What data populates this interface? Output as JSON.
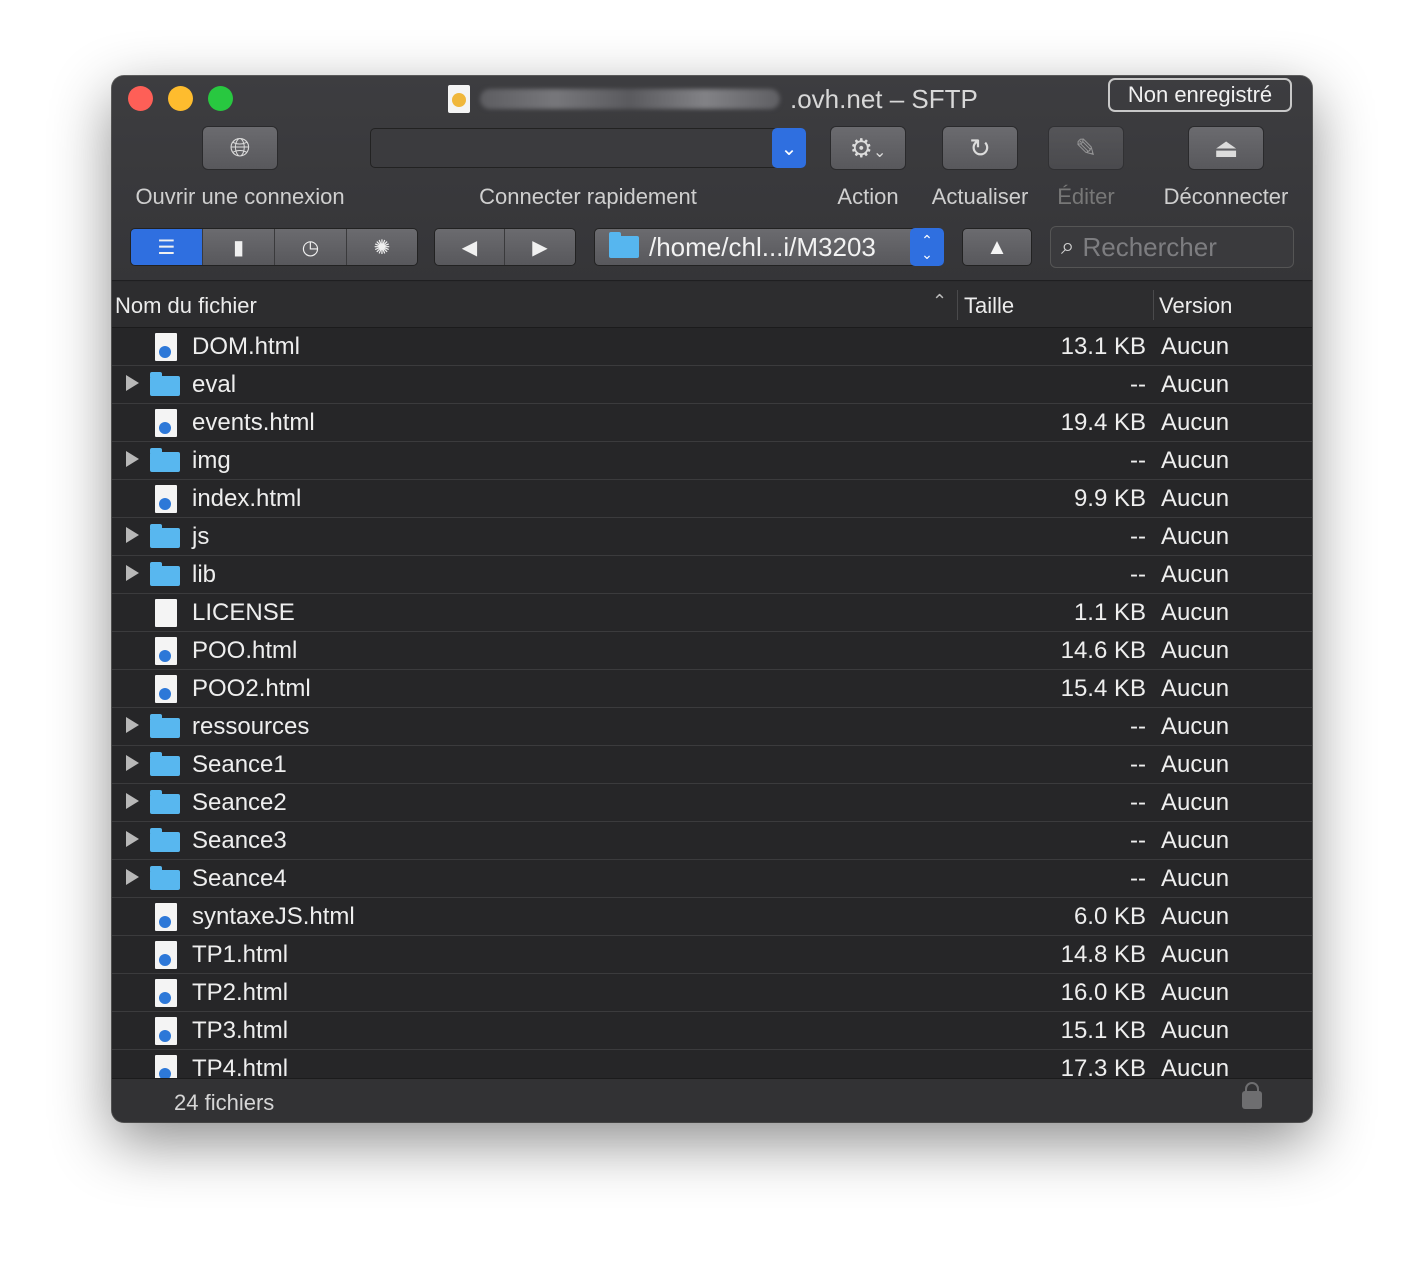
{
  "window": {
    "title_suffix": ".ovh.net – SFTP",
    "unregistered_label": "Non enregistré"
  },
  "toolbar": {
    "open_connection": "Ouvrir une connexion",
    "quick_connect": "Connecter rapidement",
    "action": "Action",
    "refresh": "Actualiser",
    "edit": "Éditer",
    "disconnect": "Déconnecter"
  },
  "navigation": {
    "path": "/home/chl...i/M3203",
    "search_placeholder": "Rechercher"
  },
  "columns": {
    "name": "Nom du fichier",
    "size": "Taille",
    "version": "Version"
  },
  "files": [
    {
      "name": "DOM.html",
      "type": "html",
      "size": "13.1 KB",
      "version": "Aucun"
    },
    {
      "name": "eval",
      "type": "folder",
      "size": "--",
      "version": "Aucun"
    },
    {
      "name": "events.html",
      "type": "html",
      "size": "19.4 KB",
      "version": "Aucun"
    },
    {
      "name": "img",
      "type": "folder",
      "size": "--",
      "version": "Aucun"
    },
    {
      "name": "index.html",
      "type": "html",
      "size": "9.9 KB",
      "version": "Aucun"
    },
    {
      "name": "js",
      "type": "folder",
      "size": "--",
      "version": "Aucun"
    },
    {
      "name": "lib",
      "type": "folder",
      "size": "--",
      "version": "Aucun"
    },
    {
      "name": "LICENSE",
      "type": "file",
      "size": "1.1 KB",
      "version": "Aucun"
    },
    {
      "name": "POO.html",
      "type": "html",
      "size": "14.6 KB",
      "version": "Aucun"
    },
    {
      "name": "POO2.html",
      "type": "html",
      "size": "15.4 KB",
      "version": "Aucun"
    },
    {
      "name": "ressources",
      "type": "folder",
      "size": "--",
      "version": "Aucun"
    },
    {
      "name": "Seance1",
      "type": "folder",
      "size": "--",
      "version": "Aucun"
    },
    {
      "name": "Seance2",
      "type": "folder",
      "size": "--",
      "version": "Aucun"
    },
    {
      "name": "Seance3",
      "type": "folder",
      "size": "--",
      "version": "Aucun"
    },
    {
      "name": "Seance4",
      "type": "folder",
      "size": "--",
      "version": "Aucun"
    },
    {
      "name": "syntaxeJS.html",
      "type": "html",
      "size": "6.0 KB",
      "version": "Aucun"
    },
    {
      "name": "TP1.html",
      "type": "html",
      "size": "14.8 KB",
      "version": "Aucun"
    },
    {
      "name": "TP2.html",
      "type": "html",
      "size": "16.0 KB",
      "version": "Aucun"
    },
    {
      "name": "TP3.html",
      "type": "html",
      "size": "15.1 KB",
      "version": "Aucun"
    },
    {
      "name": "TP4.html",
      "type": "html",
      "size": "17.3 KB",
      "version": "Aucun"
    }
  ],
  "status": {
    "file_count": "24 fichiers"
  },
  "colors": {
    "accent": "#2f6fe0",
    "folder": "#58b7ef",
    "window_bg": "#262628"
  }
}
